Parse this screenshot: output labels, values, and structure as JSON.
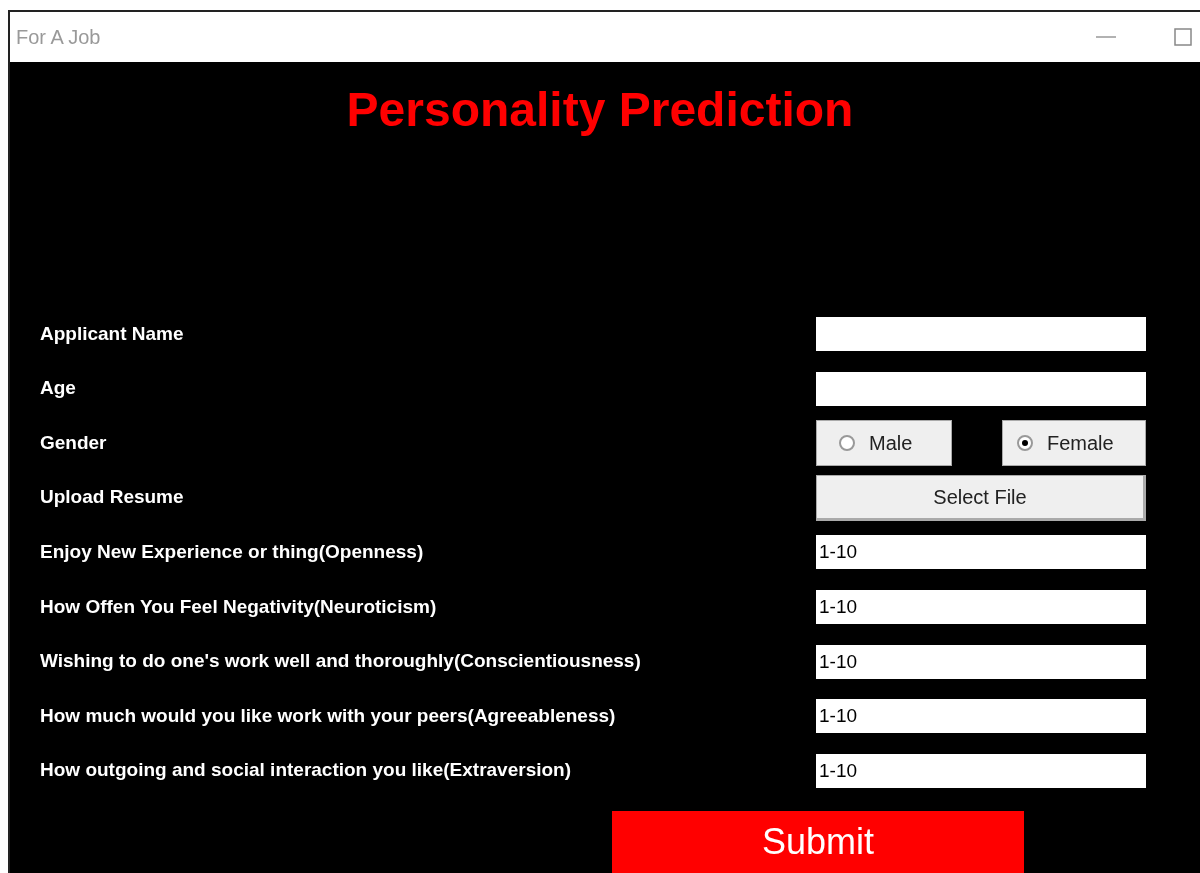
{
  "window": {
    "title": "For A Job"
  },
  "heading": "Personality Prediction",
  "rows": [
    {
      "kind": "text",
      "label": "Applicant Name"
    },
    {
      "kind": "text",
      "label": "Age"
    },
    {
      "kind": "radio",
      "label": "Gender",
      "options": [
        {
          "label": "Male",
          "selected": false
        },
        {
          "label": "Female",
          "selected": true
        }
      ]
    },
    {
      "kind": "button",
      "label": "Upload Resume",
      "button": "Select File"
    },
    {
      "kind": "text",
      "label": "Enjoy New Experience or thing(Openness)",
      "value": "1-10"
    },
    {
      "kind": "text",
      "label": "How Offen You Feel Negativity(Neuroticism)",
      "value": "1-10"
    },
    {
      "kind": "text",
      "label": "Wishing to do one's work well and thoroughly(Conscientiousness)",
      "value": "1-10"
    },
    {
      "kind": "text",
      "label": "How much would you like work with your peers(Agreeableness)",
      "value": "1-10"
    },
    {
      "kind": "text",
      "label": "How outgoing and social interaction you like(Extraversion)",
      "value": "1-10"
    }
  ],
  "submit": "Submit"
}
